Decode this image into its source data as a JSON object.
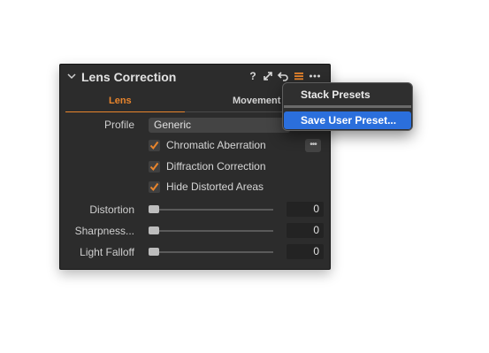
{
  "panel": {
    "title": "Lens Correction",
    "header_icons": [
      "chevron-down-icon",
      "help-icon",
      "expand-icon",
      "reset-icon",
      "presets-icon",
      "more-icon"
    ],
    "tabs": [
      {
        "label": "Lens",
        "active": true
      },
      {
        "label": "Movement",
        "active": false
      }
    ],
    "profile": {
      "label": "Profile",
      "value": "Generic"
    },
    "checkboxes": [
      {
        "label": "Chromatic Aberration",
        "checked": true
      },
      {
        "label": "Diffraction Correction",
        "checked": true
      },
      {
        "label": "Hide Distorted Areas",
        "checked": true
      }
    ],
    "sliders": [
      {
        "label": "Distortion",
        "value": "0"
      },
      {
        "label": "Sharpness...",
        "value": "0"
      },
      {
        "label": "Light Falloff",
        "value": "0"
      }
    ]
  },
  "menu": {
    "items": [
      {
        "label": "Stack Presets",
        "highlighted": false
      },
      {
        "label": "Save User Preset...",
        "highlighted": true
      }
    ]
  },
  "colors": {
    "accent": "#e9852c",
    "panel_bg": "#2c2c2c",
    "menu_highlight": "#2b6fdc"
  }
}
